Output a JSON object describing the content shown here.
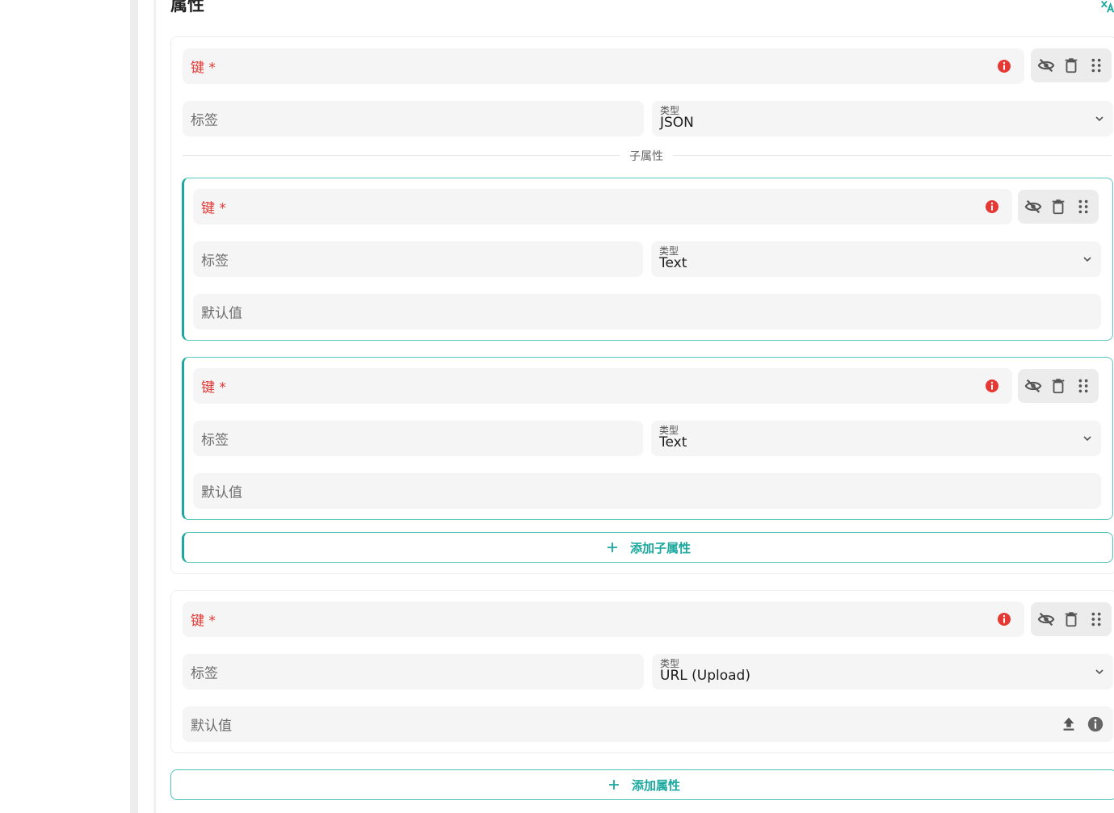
{
  "section": {
    "title": "属性"
  },
  "icons": {
    "translate": "translate-icon",
    "error": "error-icon",
    "hide": "visibility-off-icon",
    "delete": "trash-icon",
    "drag": "drag-handle-icon",
    "chevron": "chevron-down-icon",
    "upload": "upload-icon",
    "info": "info-icon",
    "plus": "plus-icon"
  },
  "colors": {
    "accent": "#1aa89f",
    "error": "#e53935",
    "field_bg": "#f5f5f5"
  },
  "property1": {
    "key_label": "键 *",
    "label_placeholder": "标签",
    "type_label": "类型",
    "type_value": "JSON",
    "subproperties_divider": "子属性",
    "children": [
      {
        "key_label": "键 *",
        "label_placeholder": "标签",
        "type_label": "类型",
        "type_value": "Text",
        "default_placeholder": "默认值"
      },
      {
        "key_label": "键 *",
        "label_placeholder": "标签",
        "type_label": "类型",
        "type_value": "Text",
        "default_placeholder": "默认值"
      }
    ],
    "add_child_label": "添加子属性"
  },
  "property2": {
    "key_label": "键 *",
    "label_placeholder": "标签",
    "type_label": "类型",
    "type_value": "URL (Upload)",
    "default_placeholder": "默认值"
  },
  "add_property_label": "添加属性"
}
